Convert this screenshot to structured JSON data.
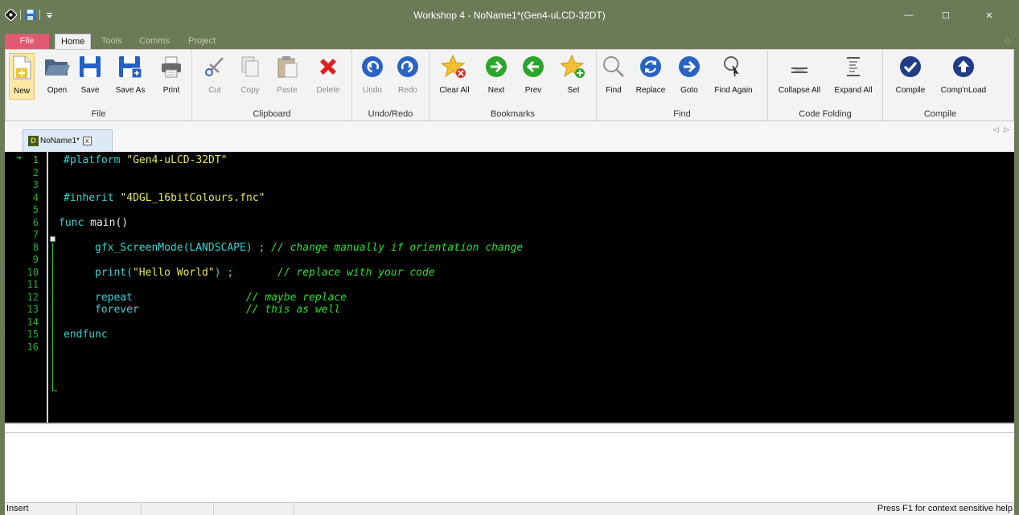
{
  "window": {
    "title": "Workshop 4 - NoName1*(Gen4-uLCD-32DT)",
    "minimize_glyph": "—",
    "maximize_glyph": "☐",
    "close_glyph": "✕"
  },
  "ribbon_tabs": [
    "File",
    "Home",
    "Tools",
    "Comms",
    "Project"
  ],
  "ribbon_help_glyph": "◇",
  "groups": {
    "file": {
      "label": "File",
      "buttons": [
        {
          "label": "New",
          "icon": "new-file-icon"
        },
        {
          "label": "Open",
          "icon": "folder-open-icon"
        },
        {
          "label": "Save",
          "icon": "save-icon"
        },
        {
          "label": "Save As",
          "icon": "save-as-icon"
        },
        {
          "label": "Print",
          "icon": "printer-icon"
        }
      ]
    },
    "clipboard": {
      "label": "Clipboard",
      "buttons": [
        {
          "label": "Cut",
          "icon": "scissors-icon"
        },
        {
          "label": "Copy",
          "icon": "copy-icon"
        },
        {
          "label": "Paste",
          "icon": "paste-icon"
        },
        {
          "label": "Delete",
          "icon": "delete-icon"
        }
      ]
    },
    "undo_redo": {
      "label": "Undo/Redo",
      "buttons": [
        {
          "label": "Undo",
          "icon": "undo-icon"
        },
        {
          "label": "Redo",
          "icon": "redo-icon"
        }
      ]
    },
    "bookmarks": {
      "label": "Bookmarks",
      "buttons": [
        {
          "label": "Clear All",
          "icon": "bookmark-clear-icon"
        },
        {
          "label": "Next",
          "icon": "bookmark-next-icon"
        },
        {
          "label": "Prev",
          "icon": "bookmark-prev-icon"
        },
        {
          "label": "Set",
          "icon": "bookmark-set-icon"
        }
      ]
    },
    "find": {
      "label": "Find",
      "buttons": [
        {
          "label": "Find",
          "icon": "magnifier-icon"
        },
        {
          "label": "Replace",
          "icon": "replace-icon"
        },
        {
          "label": "Goto",
          "icon": "goto-icon"
        },
        {
          "label": "Find Again",
          "icon": "find-again-icon"
        }
      ]
    },
    "code_folding": {
      "label": "Code Folding",
      "buttons": [
        {
          "label": "Collapse All",
          "icon": "collapse-all-icon"
        },
        {
          "label": "Expand All",
          "icon": "expand-all-icon"
        }
      ]
    },
    "compile": {
      "label": "Compile",
      "buttons": [
        {
          "label": "Compile",
          "icon": "compile-check-icon"
        },
        {
          "label": "Comp'nLoad",
          "icon": "compile-load-icon"
        }
      ]
    }
  },
  "document_tab": {
    "name": "NoName1*",
    "badge": "D",
    "close_glyph": "x"
  },
  "tab_scroll_glyph": "◁ ▷",
  "editor": {
    "line_numbers": [
      "1",
      "2",
      "3",
      "4",
      "5",
      "6",
      "7",
      "8",
      "9",
      "10",
      "11",
      "12",
      "13",
      "14",
      "15",
      "16"
    ],
    "current_line_marker": "➜",
    "lines": {
      "l1_kw": "#platform ",
      "l1_str": "\"Gen4-uLCD-32DT\"",
      "l4_kw": "#inherit ",
      "l4_str": "\"4DGL_16bitColours.fnc\"",
      "l6_kw": "func ",
      "l6_plain": "main()",
      "l8_kw": "gfx_ScreenMode(LANDSCAPE) ; ",
      "l8_cm": "// change manually if orientation change",
      "l10_kw": "print(",
      "l10_str": "\"Hello World\"",
      "l10_kw2": ") ;       ",
      "l10_cm": "// replace with your code",
      "l12_kw": "repeat                  ",
      "l12_cm": "// maybe replace",
      "l13_kw": "forever                 ",
      "l13_cm": "// this as well",
      "l15_kw": "endfunc"
    }
  },
  "status": {
    "mode": "Insert",
    "help": "Press F1 for context sensitive help"
  }
}
